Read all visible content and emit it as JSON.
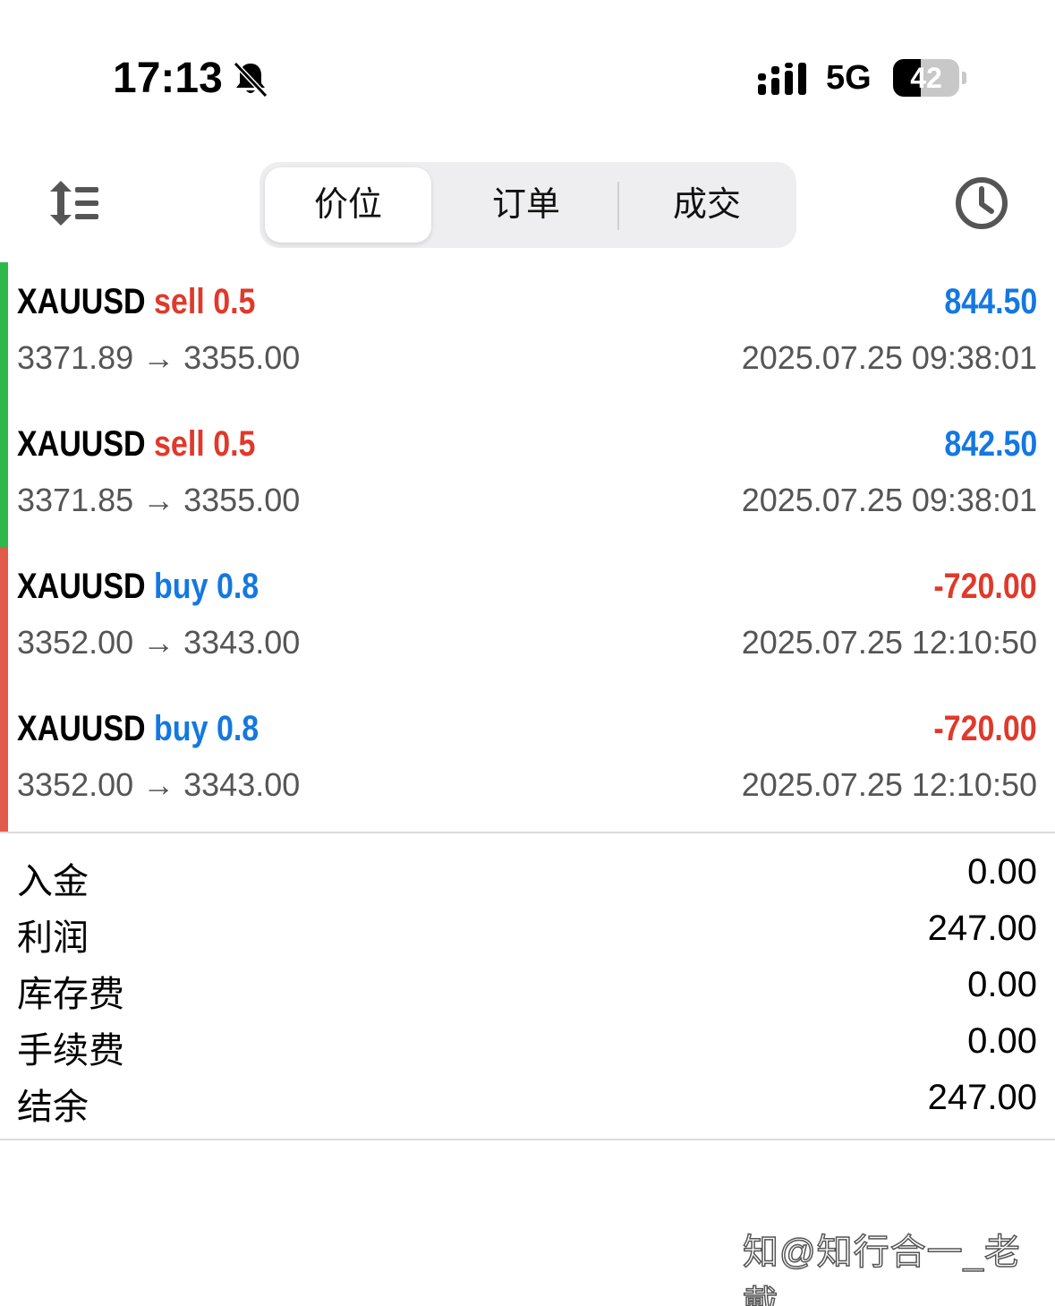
{
  "status_bar": {
    "time": "17:13",
    "network": "5G",
    "battery": "42",
    "battery_level": 0.42,
    "icons": [
      "bell-slash-icon",
      "signal-icon",
      "battery-icon"
    ]
  },
  "toolbar": {
    "sort_icon": "sort-list-icon",
    "tabs": [
      {
        "label": "价位",
        "active": true
      },
      {
        "label": "订单",
        "active": false
      },
      {
        "label": "成交",
        "active": false
      }
    ],
    "history_icon": "clock-icon"
  },
  "deals": [
    {
      "symbol": "XAUUSD",
      "side": "sell",
      "volume": "0.5",
      "profit": "844.50",
      "prices": "3371.89 → 3355.00",
      "time": "2025.07.25 09:38:01",
      "bar_color": "#2eb84b"
    },
    {
      "symbol": "XAUUSD",
      "side": "sell",
      "volume": "0.5",
      "profit": "842.50",
      "prices": "3371.85 → 3355.00",
      "time": "2025.07.25 09:38:01",
      "bar_color": "#2eb84b"
    },
    {
      "symbol": "XAUUSD",
      "side": "buy",
      "volume": "0.8",
      "profit": "-720.00",
      "prices": "3352.00 → 3343.00",
      "time": "2025.07.25 12:10:50",
      "bar_color": "#e25a4c"
    },
    {
      "symbol": "XAUUSD",
      "side": "buy",
      "volume": "0.8",
      "profit": "-720.00",
      "prices": "3352.00 → 3343.00",
      "time": "2025.07.25 12:10:50",
      "bar_color": "#e25a4c"
    }
  ],
  "summary": [
    {
      "label": "入金",
      "value": "0.00"
    },
    {
      "label": "利润",
      "value": "247.00"
    },
    {
      "label": "库存费",
      "value": "0.00"
    },
    {
      "label": "手续费",
      "value": "0.00"
    },
    {
      "label": "结余",
      "value": "247.00"
    }
  ],
  "watermark": "知@知行合一_老戴",
  "colors": {
    "sell": "#e0392b",
    "buy": "#1478e0",
    "profit_positive": "#1478e0",
    "profit_negative": "#e0392b"
  }
}
